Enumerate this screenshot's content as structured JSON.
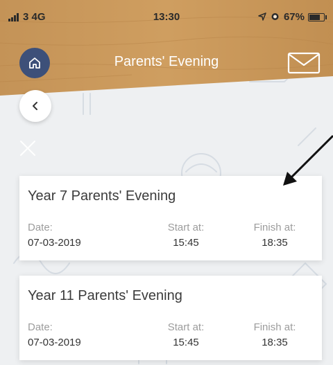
{
  "status_bar": {
    "carrier": "3  4G",
    "time": "13:30",
    "battery_text": "67%",
    "battery_level": 0.67
  },
  "nav": {
    "title": "Parents' Evening",
    "home_icon": "home-icon",
    "mail_icon": "mail-icon",
    "back_icon": "chevron-left-icon",
    "close_icon": "close-icon"
  },
  "events": [
    {
      "title": "Year 7 Parents' Evening",
      "date_label": "Date:",
      "date": "07-03-2019",
      "start_label": "Start at:",
      "start": "15:45",
      "finish_label": "Finish at:",
      "finish": "18:35"
    },
    {
      "title": "Year 11 Parents' Evening",
      "date_label": "Date:",
      "date": "07-03-2019",
      "start_label": "Start at:",
      "start": "15:45",
      "finish_label": "Finish at:",
      "finish": "18:35"
    }
  ],
  "colors": {
    "header_wood": "#c9975a",
    "home_button": "#3d5079",
    "background": "#eef0f2"
  }
}
